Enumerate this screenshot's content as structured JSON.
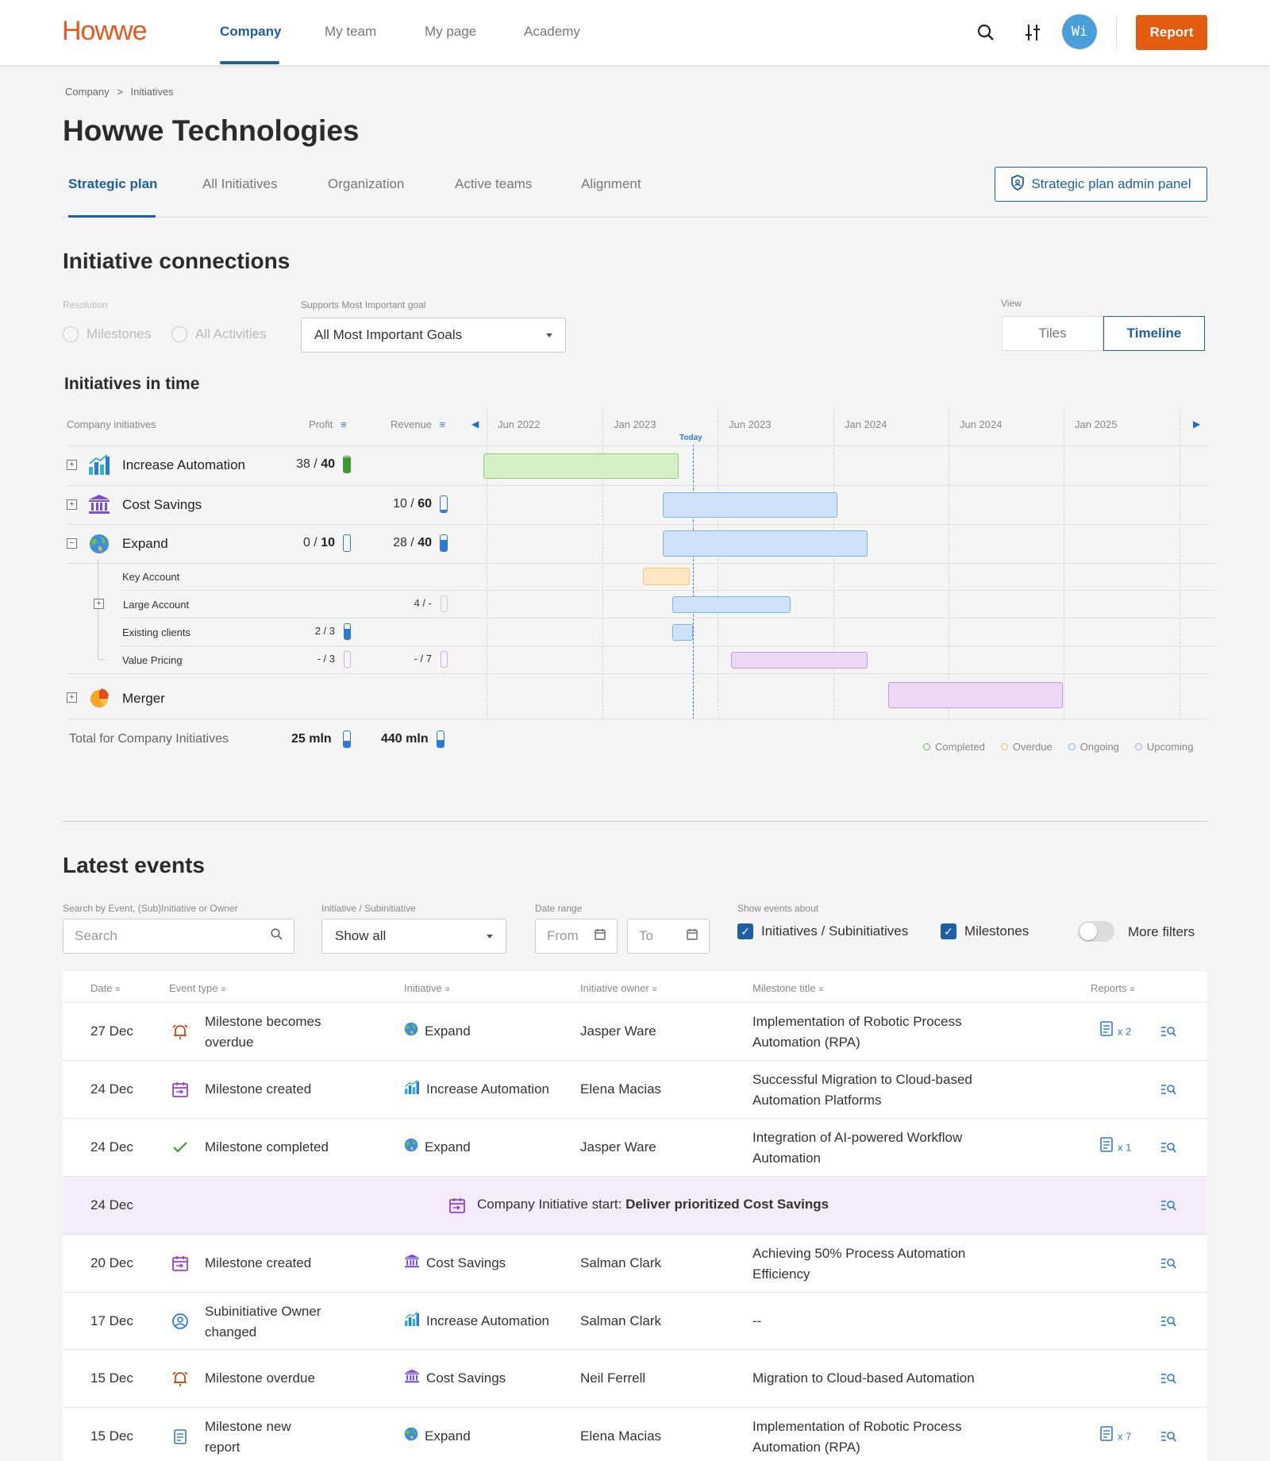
{
  "header": {
    "logo": "Howwe",
    "nav": [
      "Company",
      "My team",
      "My page",
      "Academy"
    ],
    "avatar_initials": "Wi",
    "report_label": "Report"
  },
  "breadcrumb": {
    "items": [
      "Company",
      "Initiatives"
    ],
    "sep": ">"
  },
  "page_title": "Howwe Technologies",
  "tabs": [
    "Strategic plan",
    "All Initiatives",
    "Organization",
    "Active teams",
    "Alignment"
  ],
  "admin_button": "Strategic plan admin panel",
  "connections": {
    "title": "Initiative connections",
    "resolution_label": "Resolution",
    "resolution_options": [
      "Milestones",
      "All Activities"
    ],
    "supports_label": "Supports Most Important goal",
    "supports_value": "All Most Important Goals",
    "view_label": "View",
    "view_options": [
      "Tiles",
      "Timeline"
    ],
    "view_selected": "Timeline"
  },
  "timeline": {
    "title": "Initiatives in time",
    "col_initiatives": "Company initiatives",
    "col_profit": "Profit",
    "col_revenue": "Revenue",
    "months": [
      "Jun 2022",
      "Jan 2023",
      "Jun 2023",
      "Jan 2024",
      "Jun 2024",
      "Jan 2025"
    ],
    "today_label": "Today",
    "rows": [
      {
        "name": "Increase Automation",
        "icon": "bar-chart-icon",
        "profit_cur": "38",
        "profit_tot": "40",
        "revenue_cur": "",
        "revenue_tot": "",
        "status": "completed"
      },
      {
        "name": "Cost Savings",
        "icon": "bank-icon",
        "profit_cur": "",
        "profit_tot": "",
        "revenue_cur": "10",
        "revenue_tot": "60",
        "status": "ongoing"
      },
      {
        "name": "Expand",
        "icon": "globe-icon",
        "profit_cur": "0",
        "profit_tot": "10",
        "revenue_cur": "28",
        "revenue_tot": "40",
        "status": "ongoing"
      },
      {
        "name": "Key Account",
        "sub": true,
        "profit": "",
        "revenue": "",
        "status": "overdue"
      },
      {
        "name": "Large Account",
        "sub": true,
        "profit": "",
        "revenue": "4 / -",
        "status": "ongoing"
      },
      {
        "name": "Existing clients",
        "sub": true,
        "profit": "2 / 3",
        "revenue": "",
        "status": "ongoing"
      },
      {
        "name": "Value Pricing",
        "sub": true,
        "profit": "- / 3",
        "revenue": "- / 7",
        "status": "upcoming"
      },
      {
        "name": "Merger",
        "icon": "pie-chart-icon",
        "status": "upcoming"
      }
    ],
    "total_label": "Total for Company Initiatives",
    "total_profit": "25 mln",
    "total_revenue": "440 mln",
    "legend": [
      "Completed",
      "Overdue",
      "Ongoing",
      "Upcoming"
    ],
    "colors": {
      "completed": "#8ed06c",
      "overdue": "#f6c97a",
      "ongoing": "#7cb3e8",
      "upcoming": "#c69ae0",
      "accent": "#1d5fa6",
      "brand": "#e35b0f"
    }
  },
  "events": {
    "title": "Latest events",
    "search_label": "Search by Event, (Sub)Initiative or Owner",
    "search_placeholder": "Search",
    "initiative_label": "Initiative / Subinitiative",
    "initiative_value": "Show all",
    "date_label": "Date range",
    "from_placeholder": "From",
    "to_placeholder": "To",
    "show_label": "Show events about",
    "chk_initiatives": "Initiatives / Subinitiatives",
    "chk_milestones": "Milestones",
    "more_filters": "More filters",
    "columns": [
      "Date",
      "Event type",
      "Initiative",
      "Initiative owner",
      "Milestone title",
      "Reports"
    ],
    "rows": [
      {
        "date": "27 Dec",
        "type": "Milestone becomes overdue",
        "type_icon": "alarm-icon",
        "initiative": "Expand",
        "init_icon": "globe-icon",
        "owner": "Jasper Ware",
        "milestone": "Implementation of Robotic Process Automation (RPA)",
        "reports": "x 2"
      },
      {
        "date": "24 Dec",
        "type": "Milestone created",
        "type_icon": "calendar-plus-icon",
        "initiative": "Increase Automation",
        "init_icon": "bar-chart-icon",
        "owner": "Elena Macias",
        "milestone": "Successful Migration to Cloud-based Automation Platforms",
        "reports": ""
      },
      {
        "date": "24 Dec",
        "type": "Milestone completed",
        "type_icon": "check-icon",
        "initiative": "Expand",
        "init_icon": "globe-icon",
        "owner": "Jasper Ware",
        "milestone": "Integration of AI-powered Workflow Automation",
        "reports": "x 1"
      },
      {
        "date": "24 Dec",
        "special": true,
        "prefix": "Company Initiative start:",
        "strong": "Deliver prioritized Cost Savings",
        "type_icon": "calendar-plus-icon"
      },
      {
        "date": "20 Dec",
        "type": "Milestone created",
        "type_icon": "calendar-plus-icon",
        "initiative": "Cost Savings",
        "init_icon": "bank-icon",
        "owner": "Salman Clark",
        "milestone": "Achieving 50% Process Automation Efficiency",
        "reports": ""
      },
      {
        "date": "17 Dec",
        "type": "Subinitiative Owner changed",
        "type_icon": "user-circle-icon",
        "initiative": "Increase Automation",
        "init_icon": "bar-chart-icon",
        "owner": "Salman Clark",
        "milestone": "--",
        "reports": ""
      },
      {
        "date": "15 Dec",
        "type": "Milestone overdue",
        "type_icon": "alarm-icon",
        "initiative": "Cost Savings",
        "init_icon": "bank-icon",
        "owner": "Neil Ferrell",
        "milestone": "Migration to Cloud-based Automation",
        "reports": ""
      },
      {
        "date": "15 Dec",
        "type": "Milestone new report",
        "type_icon": "report-icon",
        "initiative": "Expand",
        "init_icon": "globe-icon",
        "owner": "Elena Macias",
        "milestone": "Implementation of Robotic Process Automation (RPA)",
        "reports": "x 7"
      }
    ]
  }
}
